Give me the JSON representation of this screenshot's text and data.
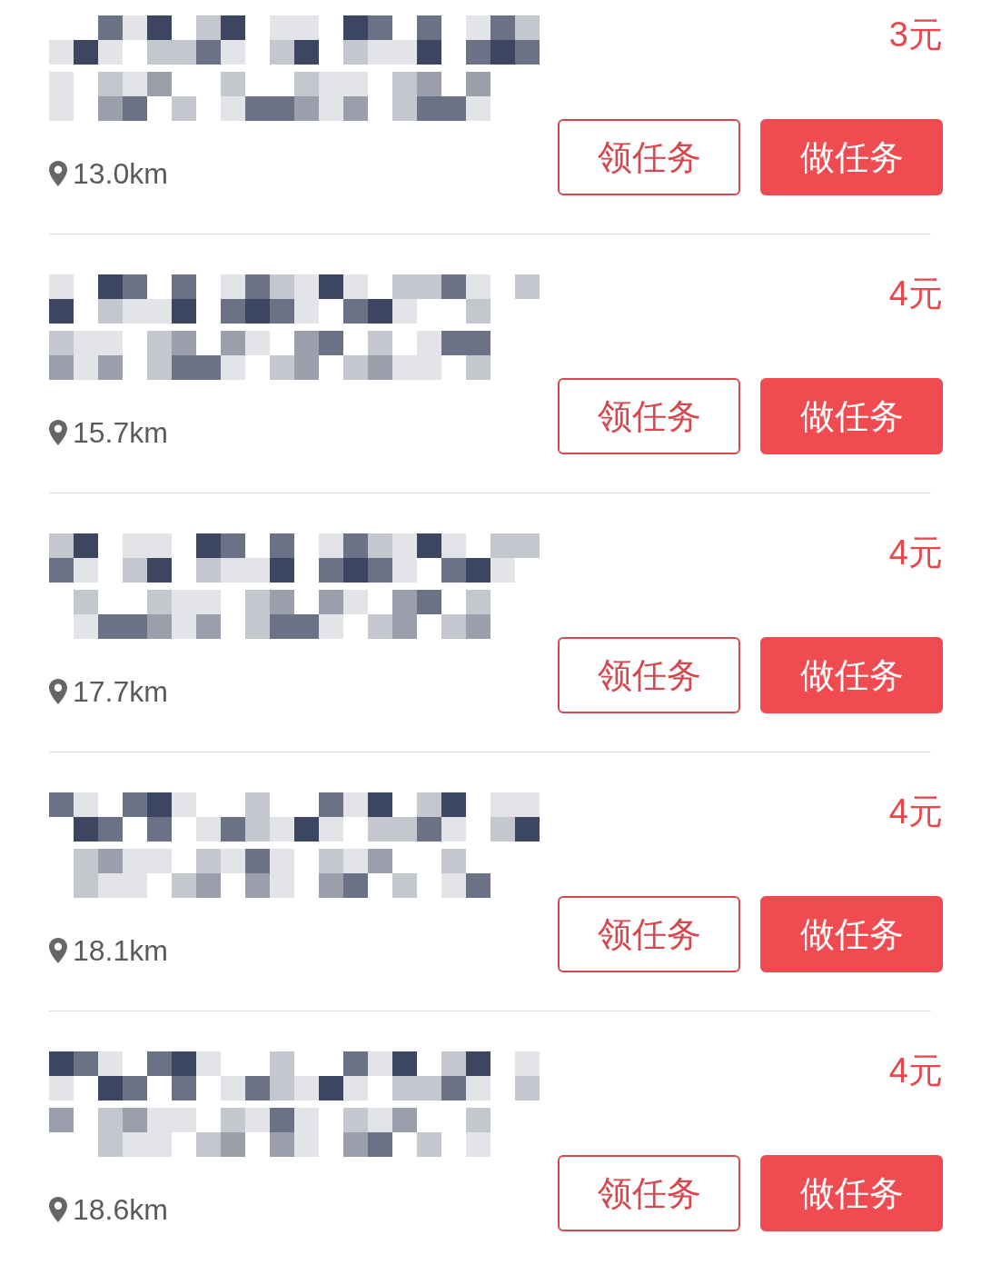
{
  "tasks": [
    {
      "price": "3元",
      "distance": "13.0km",
      "buttons": [
        {
          "label": "领任务",
          "kind": "outline"
        },
        {
          "label": "做任务",
          "kind": "filled"
        }
      ]
    },
    {
      "price": "4元",
      "distance": "15.7km",
      "buttons": [
        {
          "label": "领任务",
          "kind": "outline"
        },
        {
          "label": "做任务",
          "kind": "filled"
        }
      ]
    },
    {
      "price": "4元",
      "distance": "17.7km",
      "buttons": [
        {
          "label": "领任务",
          "kind": "outline"
        },
        {
          "label": "做任务",
          "kind": "filled"
        }
      ]
    },
    {
      "price": "4元",
      "distance": "18.1km",
      "buttons": [
        {
          "label": "领任务",
          "kind": "outline"
        },
        {
          "label": "做任务",
          "kind": "filled"
        }
      ]
    },
    {
      "price": "4元",
      "distance": "18.6km",
      "buttons": [
        {
          "label": "领任务",
          "kind": "outline"
        },
        {
          "label": "做任务",
          "kind": "filled"
        }
      ]
    }
  ]
}
